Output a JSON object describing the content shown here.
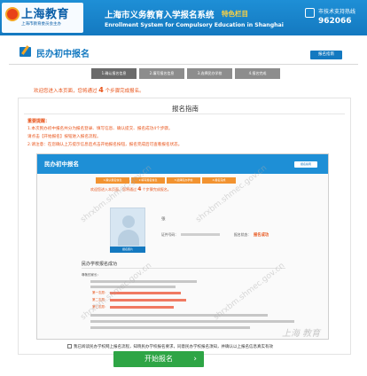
{
  "header": {
    "logo_title": "上海教育",
    "logo_sub": "上海市教育委员会主办",
    "system_title": "上海市义务教育入学报名系统",
    "system_tag": "特色栏目",
    "system_en": "Enrollment System for Compulsory Education in Shanghai",
    "hotline_label": "市技术支持热线",
    "hotline_number": "962066",
    "brand_color": "#1479c0"
  },
  "page": {
    "title": "民办初中报名",
    "guide_button": "报名指南",
    "steps": [
      "1.确认报名信息",
      "2.填写报名信息",
      "3.选择民办学校",
      "4.报名完成"
    ],
    "notice_prefix": "欢迎您进入本页面，您将通过",
    "notice_number": "4",
    "notice_suffix": "个步骤完成报名。"
  },
  "guide": {
    "title": "报名指南",
    "tips_head": "重要提醒：",
    "tips": [
      "1.本次民办初中报名共分为报名登录、填写信息、确认提交、报名成功4个步骤。",
      "请点击【开始报名】按钮进入报名流程。",
      "2.请注意：在您确认上方提示信息后点击开始报名按钮，报名完成后可查看报名状态。"
    ],
    "screenshot": {
      "title": "民办初中报名",
      "guide_button": "报名指南",
      "steps": [
        "1.确认报名信息",
        "2.填写报名信息",
        "3.选择民办学校",
        "4.报名完成"
      ],
      "notice_prefix": "欢迎您进入本页面，您将通过",
      "notice_number": "4",
      "notice_suffix": "个步骤完成报名。",
      "avatar_tag": "报名照片",
      "name_label": "张",
      "id_label": "证件号码：",
      "status_label": "报名状态：",
      "status_value": "报名成功",
      "success_head": "民办学校报名成功",
      "line_dear": "尊敬的家长：",
      "line_first": "第一志愿：",
      "line_second": "第二志愿：",
      "line_third": "第三志愿：",
      "watermark": "shrxbm.shmec.gov.cn"
    }
  },
  "consent": "我已阅读民办学校网上报名流程，知晓民办学校报名要求，同意民办学校报名须知，并确认以上报名信息真实有效",
  "start_button": "开始报名",
  "brand_watermark": "上海  教育"
}
